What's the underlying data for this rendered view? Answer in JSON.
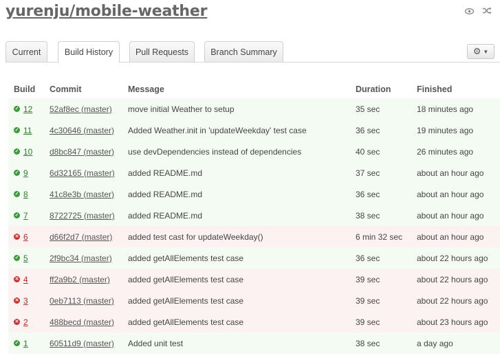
{
  "repo": {
    "title": "yurenju/mobile-weather"
  },
  "header_icons": [
    "eye-icon",
    "shuffle-icon"
  ],
  "tabs": [
    {
      "label": "Current",
      "active": false
    },
    {
      "label": "Build History",
      "active": true
    },
    {
      "label": "Pull Requests",
      "active": false
    },
    {
      "label": "Branch Summary",
      "active": false
    }
  ],
  "settings": {
    "icon": "gear-icon"
  },
  "colors": {
    "passed": "#3c9a3c",
    "failed": "#c83232",
    "passed_row": "#f4fbf2",
    "failed_row": "#fcf2f2"
  },
  "table": {
    "headers": {
      "build": "Build",
      "commit": "Commit",
      "message": "Message",
      "duration": "Duration",
      "finished": "Finished"
    },
    "rows": [
      {
        "status": "passed",
        "build": "12",
        "commit": "52af8ec (master)",
        "message": "move initial Weather to setup",
        "duration": "35 sec",
        "finished": "18 minutes ago"
      },
      {
        "status": "passed",
        "build": "11",
        "commit": "4c30646 (master)",
        "message": "Added Weather.init in 'updateWeekday' test case",
        "duration": "36 sec",
        "finished": "19 minutes ago"
      },
      {
        "status": "passed",
        "build": "10",
        "commit": "d8bc847 (master)",
        "message": "use devDependencies instead of dependencies",
        "duration": "40 sec",
        "finished": "26 minutes ago"
      },
      {
        "status": "passed",
        "build": "9",
        "commit": "6d32165 (master)",
        "message": "added README.md",
        "duration": "37 sec",
        "finished": "about an hour ago"
      },
      {
        "status": "passed",
        "build": "8",
        "commit": "41c8e3b (master)",
        "message": "added README.md",
        "duration": "36 sec",
        "finished": "about an hour ago"
      },
      {
        "status": "passed",
        "build": "7",
        "commit": "8722725 (master)",
        "message": "added README.md",
        "duration": "38 sec",
        "finished": "about an hour ago"
      },
      {
        "status": "failed",
        "build": "6",
        "commit": "d66f2d7 (master)",
        "message": "added test cast for updateWeekday()",
        "duration": "6 min 32 sec",
        "finished": "about an hour ago"
      },
      {
        "status": "passed",
        "build": "5",
        "commit": "2f9bc34 (master)",
        "message": "added getAllElements test case",
        "duration": "36 sec",
        "finished": "about 22 hours ago"
      },
      {
        "status": "failed",
        "build": "4",
        "commit": "ff2a9b2 (master)",
        "message": "added getAllElements test case",
        "duration": "39 sec",
        "finished": "about 22 hours ago"
      },
      {
        "status": "failed",
        "build": "3",
        "commit": "0eb7113 (master)",
        "message": "added getAllElements test case",
        "duration": "39 sec",
        "finished": "about 22 hours ago"
      },
      {
        "status": "failed",
        "build": "2",
        "commit": "488becd (master)",
        "message": "added getAllElements test case",
        "duration": "39 sec",
        "finished": "about 23 hours ago"
      },
      {
        "status": "passed",
        "build": "1",
        "commit": "60511d9 (master)",
        "message": "Added unit test",
        "duration": "38 sec",
        "finished": "a day ago"
      }
    ]
  }
}
